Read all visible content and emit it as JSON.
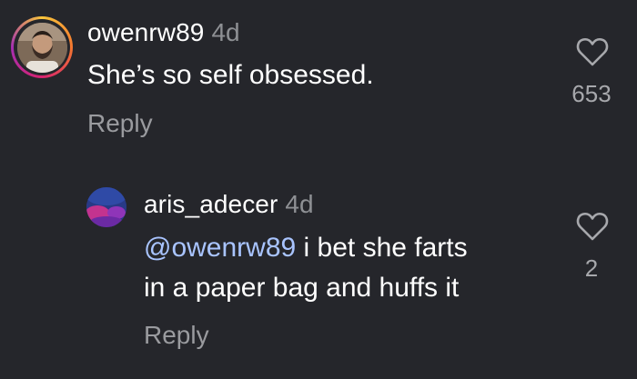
{
  "comments": [
    {
      "username": "owenrw89",
      "time": "4d",
      "text": "She’s so self obsessed.",
      "reply_label": "Reply",
      "like_count": "653",
      "avatar_icon": "profile-photo-man-beard"
    }
  ],
  "replies": [
    {
      "username": "aris_adecer",
      "time": "4d",
      "mention": "@owenrw89",
      "text_line1": " i bet she farts",
      "text_line2": "in a paper bag and huffs it",
      "reply_label": "Reply",
      "like_count": "2",
      "avatar_icon": "profile-photo-abstract-purple"
    }
  ],
  "colors": {
    "background": "#25262b",
    "mention": "#a9c4ff",
    "secondary_text": "#9a9b9f"
  }
}
